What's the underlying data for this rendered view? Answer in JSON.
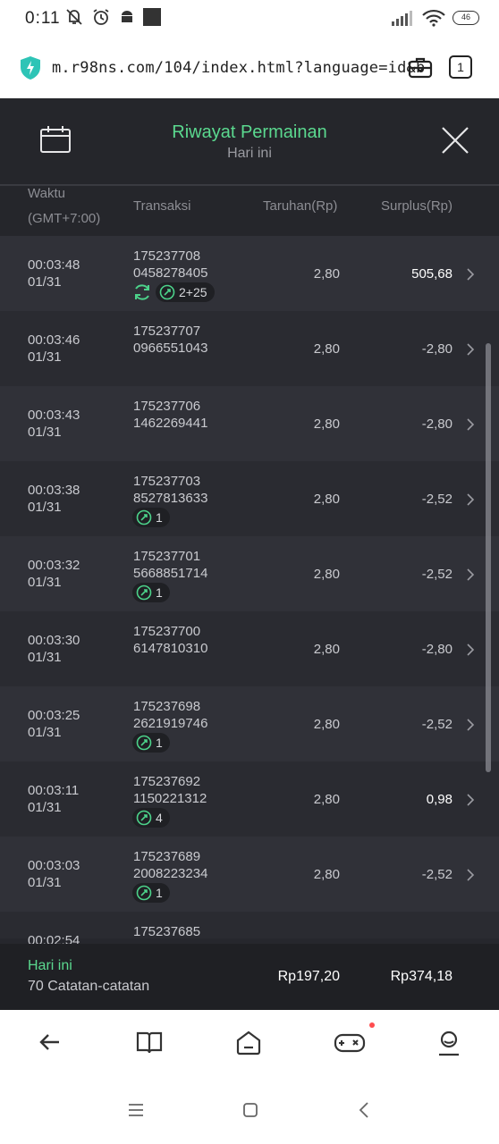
{
  "status_bar": {
    "time": "0:11",
    "battery": "46"
  },
  "url_bar": {
    "url": "m.r98ns.com/104/index.html?language=id&b",
    "tab_count": "1"
  },
  "header": {
    "title": "Riwayat Permainan",
    "subtitle": "Hari ini"
  },
  "columns": {
    "time_line1": "Waktu",
    "time_line2": "(GMT+7:00)",
    "transaction": "Transaksi",
    "bet": "Taruhan(Rp)",
    "surplus": "Surplus(Rp)"
  },
  "rows": [
    {
      "time": "00:03:48",
      "date": "01/31",
      "tx1": "175237708",
      "tx2": "0458278405",
      "bet": "2,80",
      "surplus": "505,68",
      "positive": true,
      "refresh": true,
      "badge": "2+25"
    },
    {
      "time": "00:03:46",
      "date": "01/31",
      "tx1": "175237707",
      "tx2": "0966551043",
      "bet": "2,80",
      "surplus": "-2,80",
      "positive": false,
      "refresh": false,
      "badge": ""
    },
    {
      "time": "00:03:43",
      "date": "01/31",
      "tx1": "175237706",
      "tx2": "1462269441",
      "bet": "2,80",
      "surplus": "-2,80",
      "positive": false,
      "refresh": false,
      "badge": ""
    },
    {
      "time": "00:03:38",
      "date": "01/31",
      "tx1": "175237703",
      "tx2": "8527813633",
      "bet": "2,80",
      "surplus": "-2,52",
      "positive": false,
      "refresh": false,
      "badge": "1"
    },
    {
      "time": "00:03:32",
      "date": "01/31",
      "tx1": "175237701",
      "tx2": "5668851714",
      "bet": "2,80",
      "surplus": "-2,52",
      "positive": false,
      "refresh": false,
      "badge": "1"
    },
    {
      "time": "00:03:30",
      "date": "01/31",
      "tx1": "175237700",
      "tx2": "6147810310",
      "bet": "2,80",
      "surplus": "-2,80",
      "positive": false,
      "refresh": false,
      "badge": ""
    },
    {
      "time": "00:03:25",
      "date": "01/31",
      "tx1": "175237698",
      "tx2": "2621919746",
      "bet": "2,80",
      "surplus": "-2,52",
      "positive": false,
      "refresh": false,
      "badge": "1"
    },
    {
      "time": "00:03:11",
      "date": "01/31",
      "tx1": "175237692",
      "tx2": "1150221312",
      "bet": "2,80",
      "surplus": "0,98",
      "positive": true,
      "refresh": false,
      "badge": "4"
    },
    {
      "time": "00:03:03",
      "date": "01/31",
      "tx1": "175237689",
      "tx2": "2008223234",
      "bet": "2,80",
      "surplus": "-2,52",
      "positive": false,
      "refresh": false,
      "badge": "1"
    },
    {
      "time": "00:02:54",
      "date": "",
      "tx1": "175237685",
      "tx2": "",
      "bet": "",
      "surplus": "",
      "positive": false,
      "refresh": false,
      "badge": "",
      "partial": true
    }
  ],
  "summary": {
    "label": "Hari ini",
    "count": "70 Catatan-catatan",
    "total_bet": "Rp197,20",
    "total_surplus": "Rp374,18"
  },
  "colors": {
    "accent_green": "#5bd98f",
    "background": "#26272d",
    "row_light": "#303138",
    "row_dark": "#2a2b31"
  },
  "bottom_nav": [
    "back-arrow-icon",
    "book-icon",
    "home-icon",
    "gamepad-icon",
    "profile-icon"
  ],
  "system_nav": [
    "recents-icon",
    "home-square-icon",
    "back-chevron-icon"
  ]
}
